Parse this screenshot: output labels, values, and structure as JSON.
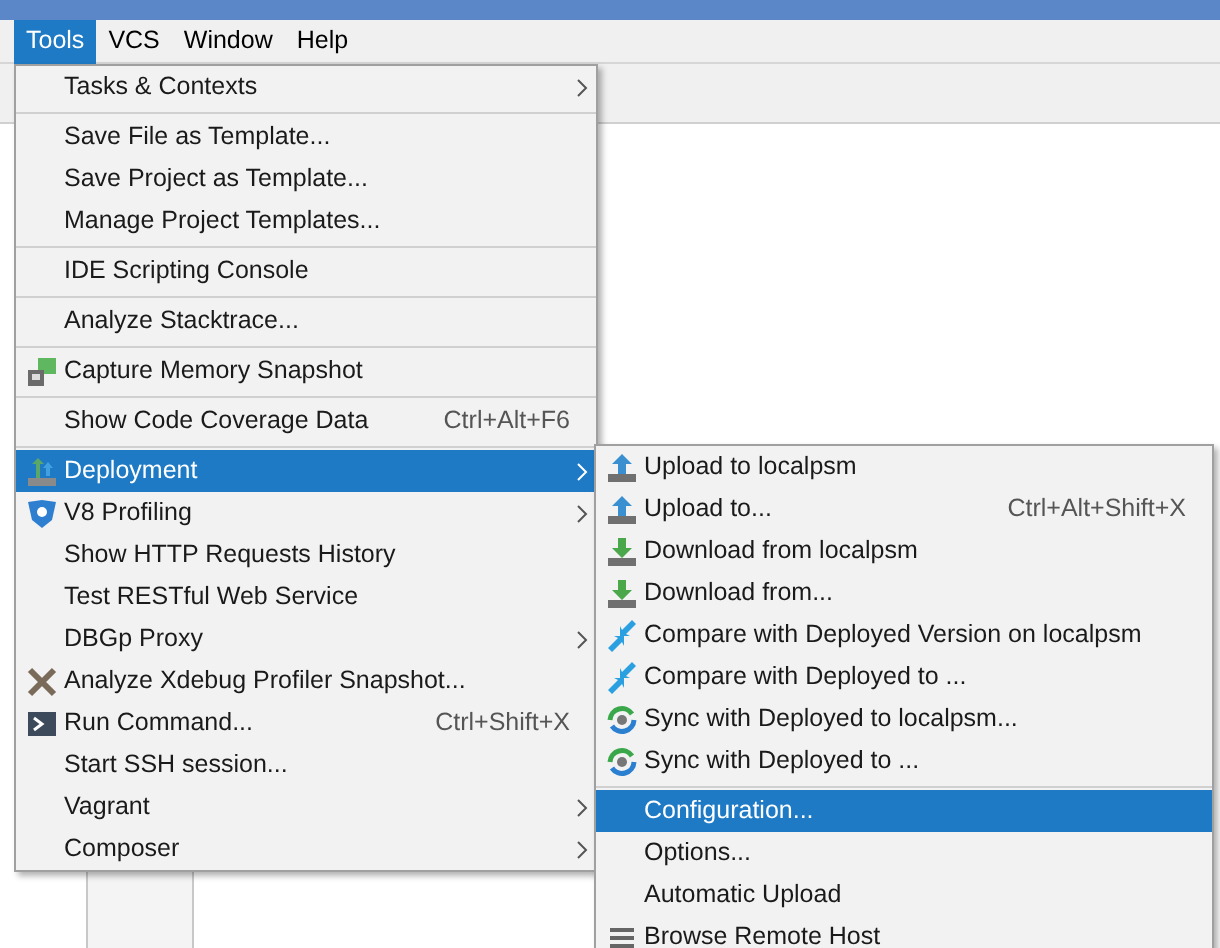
{
  "menubar": [
    {
      "label": "Tools",
      "selected": true
    },
    {
      "label": "VCS",
      "selected": false
    },
    {
      "label": "Window",
      "selected": false
    },
    {
      "label": "Help",
      "selected": false
    }
  ],
  "tools_menu": {
    "items": [
      {
        "kind": "item",
        "label": "Tasks & Contexts",
        "submenu": true,
        "selected": false
      },
      {
        "kind": "separator"
      },
      {
        "kind": "item",
        "label": "Save File as Template...",
        "selected": false
      },
      {
        "kind": "item",
        "label": "Save Project as Template...",
        "selected": false
      },
      {
        "kind": "item",
        "label": "Manage Project Templates...",
        "selected": false
      },
      {
        "kind": "separator"
      },
      {
        "kind": "item",
        "label": "IDE Scripting Console",
        "selected": false
      },
      {
        "kind": "separator"
      },
      {
        "kind": "item",
        "label": "Analyze Stacktrace...",
        "selected": false
      },
      {
        "kind": "separator"
      },
      {
        "kind": "item",
        "label": "Capture Memory Snapshot",
        "selected": false
      },
      {
        "kind": "separator"
      },
      {
        "kind": "item",
        "label": "Show Code Coverage Data",
        "shortcut": "Ctrl+Alt+F6",
        "selected": false
      },
      {
        "kind": "separator"
      },
      {
        "kind": "item",
        "label": "Deployment",
        "submenu": true,
        "selected": true
      },
      {
        "kind": "item",
        "label": "V8 Profiling",
        "submenu": true,
        "selected": false
      },
      {
        "kind": "item",
        "label": "Show HTTP Requests History",
        "selected": false
      },
      {
        "kind": "item",
        "label": "Test RESTful Web Service",
        "selected": false
      },
      {
        "kind": "item",
        "label": "DBGp Proxy",
        "submenu": true,
        "selected": false
      },
      {
        "kind": "item",
        "label": "Analyze Xdebug Profiler Snapshot...",
        "selected": false
      },
      {
        "kind": "item",
        "label": "Run Command...",
        "shortcut": "Ctrl+Shift+X",
        "selected": false
      },
      {
        "kind": "item",
        "label": "Start SSH session...",
        "selected": false
      },
      {
        "kind": "item",
        "label": "Vagrant",
        "submenu": true,
        "selected": false
      },
      {
        "kind": "item",
        "label": "Composer",
        "submenu": true,
        "selected": false
      }
    ]
  },
  "deployment_menu": {
    "items": [
      {
        "kind": "item",
        "label": "Upload to localpsm",
        "selected": false
      },
      {
        "kind": "item",
        "label": "Upload to...",
        "shortcut": "Ctrl+Alt+Shift+X",
        "selected": false
      },
      {
        "kind": "item",
        "label": "Download from localpsm",
        "selected": false
      },
      {
        "kind": "item",
        "label": "Download from...",
        "selected": false
      },
      {
        "kind": "item",
        "label": "Compare with Deployed Version on localpsm",
        "selected": false
      },
      {
        "kind": "item",
        "label": "Compare with Deployed to ...",
        "selected": false
      },
      {
        "kind": "item",
        "label": "Sync with Deployed to localpsm...",
        "selected": false
      },
      {
        "kind": "item",
        "label": "Sync with Deployed to ...",
        "selected": false
      },
      {
        "kind": "separator"
      },
      {
        "kind": "item",
        "label": "Configuration...",
        "selected": true
      },
      {
        "kind": "item",
        "label": "Options...",
        "selected": false
      },
      {
        "kind": "item",
        "label": "Automatic Upload",
        "selected": false
      },
      {
        "kind": "item",
        "label": "Browse Remote Host",
        "selected": false
      }
    ]
  }
}
